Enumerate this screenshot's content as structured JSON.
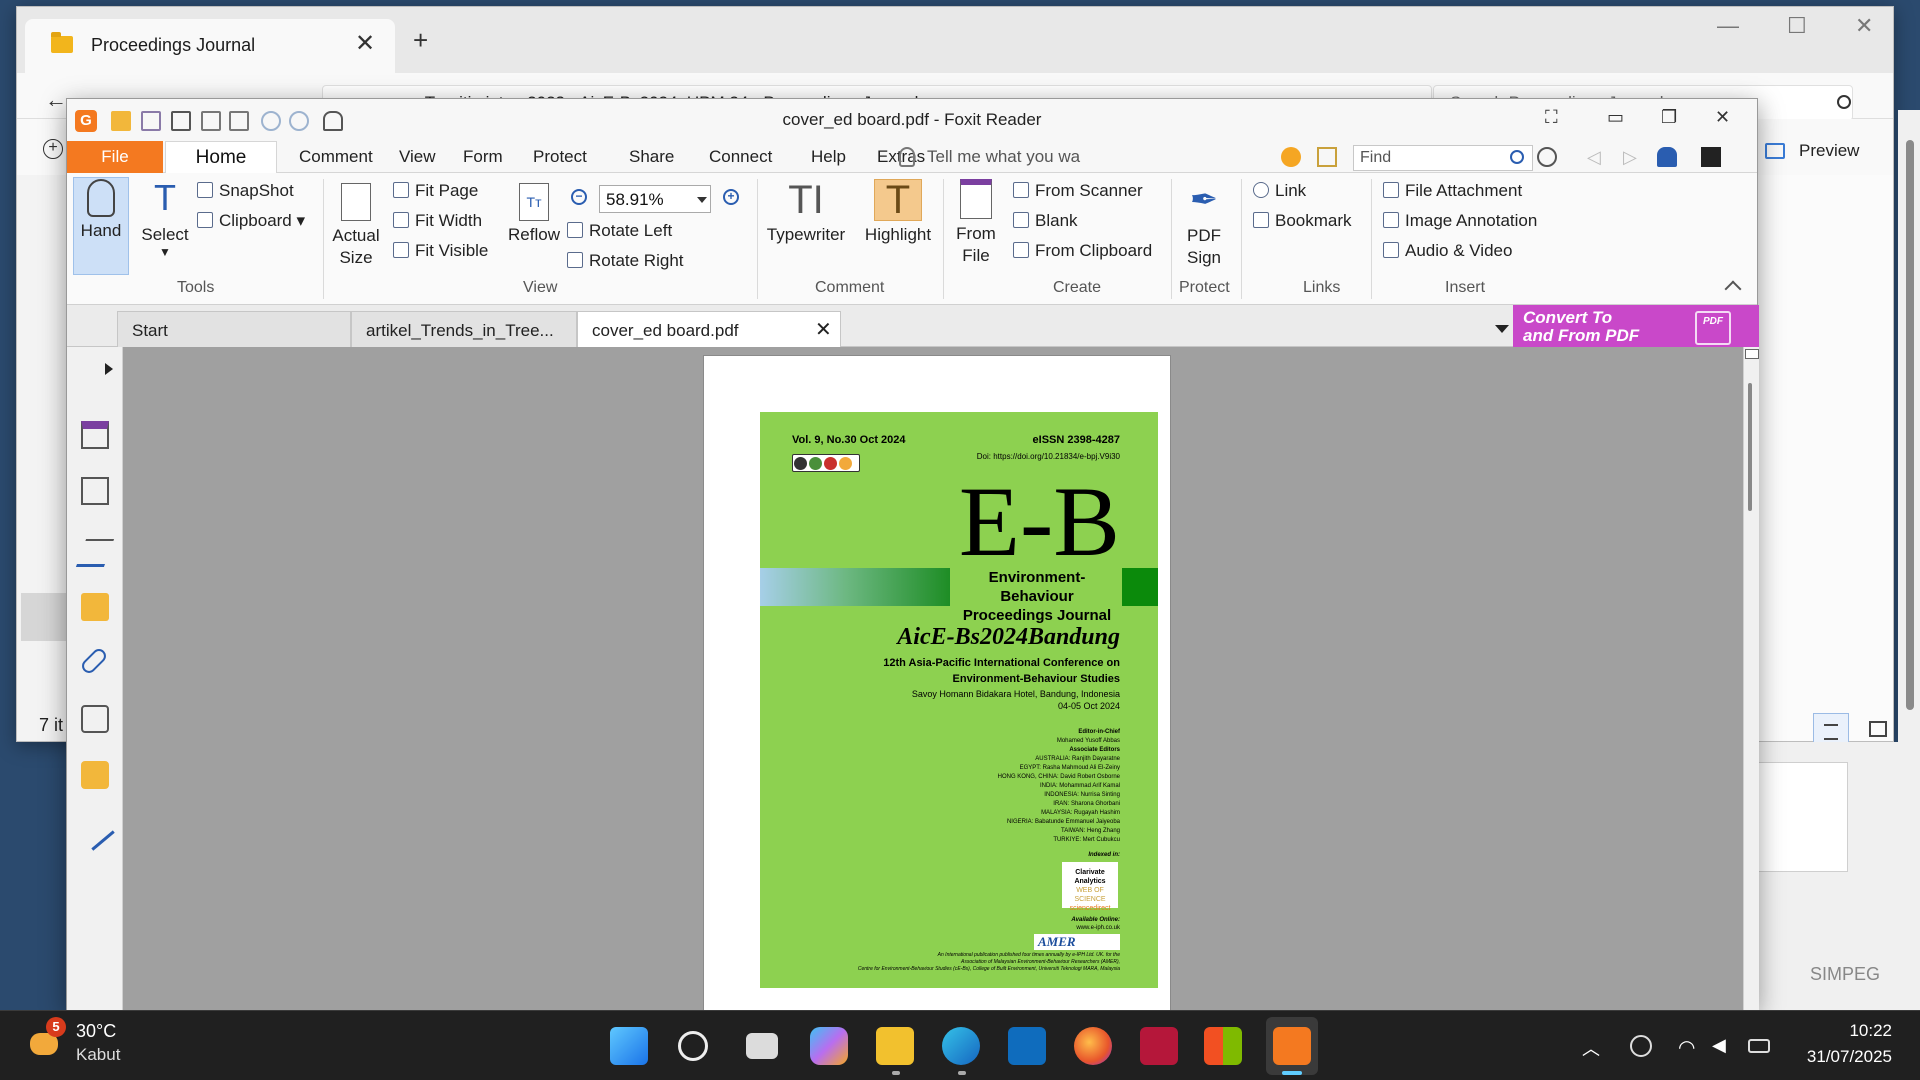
{
  "explorer": {
    "tab_title": "Proceedings Journal",
    "tab_close": "✕",
    "new_tab": "+",
    "breadcrumb": "…  ›  Turnitin intan 2023  ›  AicE-Bs2024_UPM 24  ›  Proceedings Journal",
    "search_placeholder": "Search Proceedings Journal",
    "preview_label": "Preview",
    "item_count": "7 it",
    "window_controls": {
      "minimize": "—",
      "maximize": "☐",
      "close": "✕"
    }
  },
  "background_app": {
    "label": "SIMPEG"
  },
  "foxit": {
    "title": "cover_ed board.pdf - Foxit Reader",
    "menu": {
      "file": "File",
      "items": [
        "Home",
        "Comment",
        "View",
        "Form",
        "Protect",
        "Share",
        "Connect",
        "Help",
        "Extras"
      ],
      "tell_me": "Tell me what you wa",
      "find_placeholder": "Find"
    },
    "ribbon": {
      "tools": {
        "hand": "Hand",
        "select": "Select",
        "snapshot": "SnapShot",
        "clipboard": "Clipboard",
        "label": "Tools"
      },
      "view": {
        "actual_size": "Actual Size",
        "fit_page": "Fit Page",
        "fit_width": "Fit Width",
        "fit_visible": "Fit Visible",
        "reflow": "Reflow",
        "zoom": "58.91%",
        "rotate_left": "Rotate Left",
        "rotate_right": "Rotate Right",
        "label": "View"
      },
      "comment": {
        "typewriter": "Typewriter",
        "highlight": "Highlight",
        "label": "Comment"
      },
      "create": {
        "from_file": "From File",
        "from_scanner": "From Scanner",
        "blank": "Blank",
        "from_clipboard": "From Clipboard",
        "label": "Create"
      },
      "protect": {
        "pdf_sign": "PDF Sign",
        "label": "Protect"
      },
      "links": {
        "link": "Link",
        "bookmark": "Bookmark",
        "label": "Links"
      },
      "insert": {
        "file_attachment": "File Attachment",
        "image_annotation": "Image Annotation",
        "audio_video": "Audio & Video",
        "label": "Insert"
      }
    },
    "doc_tabs": [
      {
        "label": "Start"
      },
      {
        "label": "artikel_Trends_in_Tree..."
      },
      {
        "label": "cover_ed board.pdf"
      }
    ],
    "doc_tab_close": "✕",
    "convert_banner": {
      "line1": "Convert To",
      "line2": "and From PDF",
      "badge": "PDF"
    },
    "cover": {
      "vol": "Vol. 9, No.30   Oct 2024",
      "issn": "eISSN 2398-4287",
      "doi": "Doi: https://doi.org/10.21834/e-bpj.V9i30",
      "eb": "E-B",
      "journal_line1": "Environment-Behaviour",
      "journal_line2": "Proceedings  Journal",
      "conf": "AicE-Bs2024Bandung",
      "conf_line1": "12th Asia-Pacific International Conference on",
      "conf_line2": "Environment-Behaviour Studies",
      "venue": "Savoy Homann Bidakara Hotel, Bandung, Indonesia",
      "date": "04-05 Oct 2024",
      "editors": [
        "Editor-in-Chief",
        "Mohamed Yusoff Abbas",
        "Associate Editors",
        "AUSTRALIA: Ranjith Dayaratne",
        "EGYPT: Rasha Mahmoud Ali El-Zeiny",
        "HONG KONG, CHINA: David Robert Osborne",
        "INDIA: Mohammad Arif Kamal",
        "INDONESIA: Nurrisa Sinting",
        "IRAN: Sharona Ghorbani",
        "MALAYSIA: Rugayah Hashim",
        "NIGERIA: Babatunde Emmanuel Jaiyeoba",
        "TAIWAN: Heng Zhang",
        "TURKIYE: Mert Cubukcu"
      ],
      "indexed": "Indexed in:",
      "clarivate": "Clarivate Analytics",
      "wos": "WEB OF SCIENCE",
      "sciencedirect": "sciencedirect",
      "available_online": "Available Online:",
      "available_url": "www.e-iph.co.uk",
      "amer": "AMER",
      "footer": [
        "An International publication published four times annually by e-IPH Ltd. UK. for the",
        "Association of Malaysian Environment-Behaviour Researchers (AMER),",
        "Centre for Environment-Behaviour Studies (cE-Bs), College of Built Environment, Universiti Teknologi MARA, Malaysia"
      ]
    }
  },
  "taskbar": {
    "weather_badge": "5",
    "temperature": "30°C",
    "weather": "Kabut",
    "time": "10:22",
    "date": "31/07/2025"
  },
  "colors": {
    "foxit_orange": "#f47920",
    "cover_green": "#8dd150",
    "banner_magenta": "#c948c9",
    "taskbar": "#202020"
  }
}
